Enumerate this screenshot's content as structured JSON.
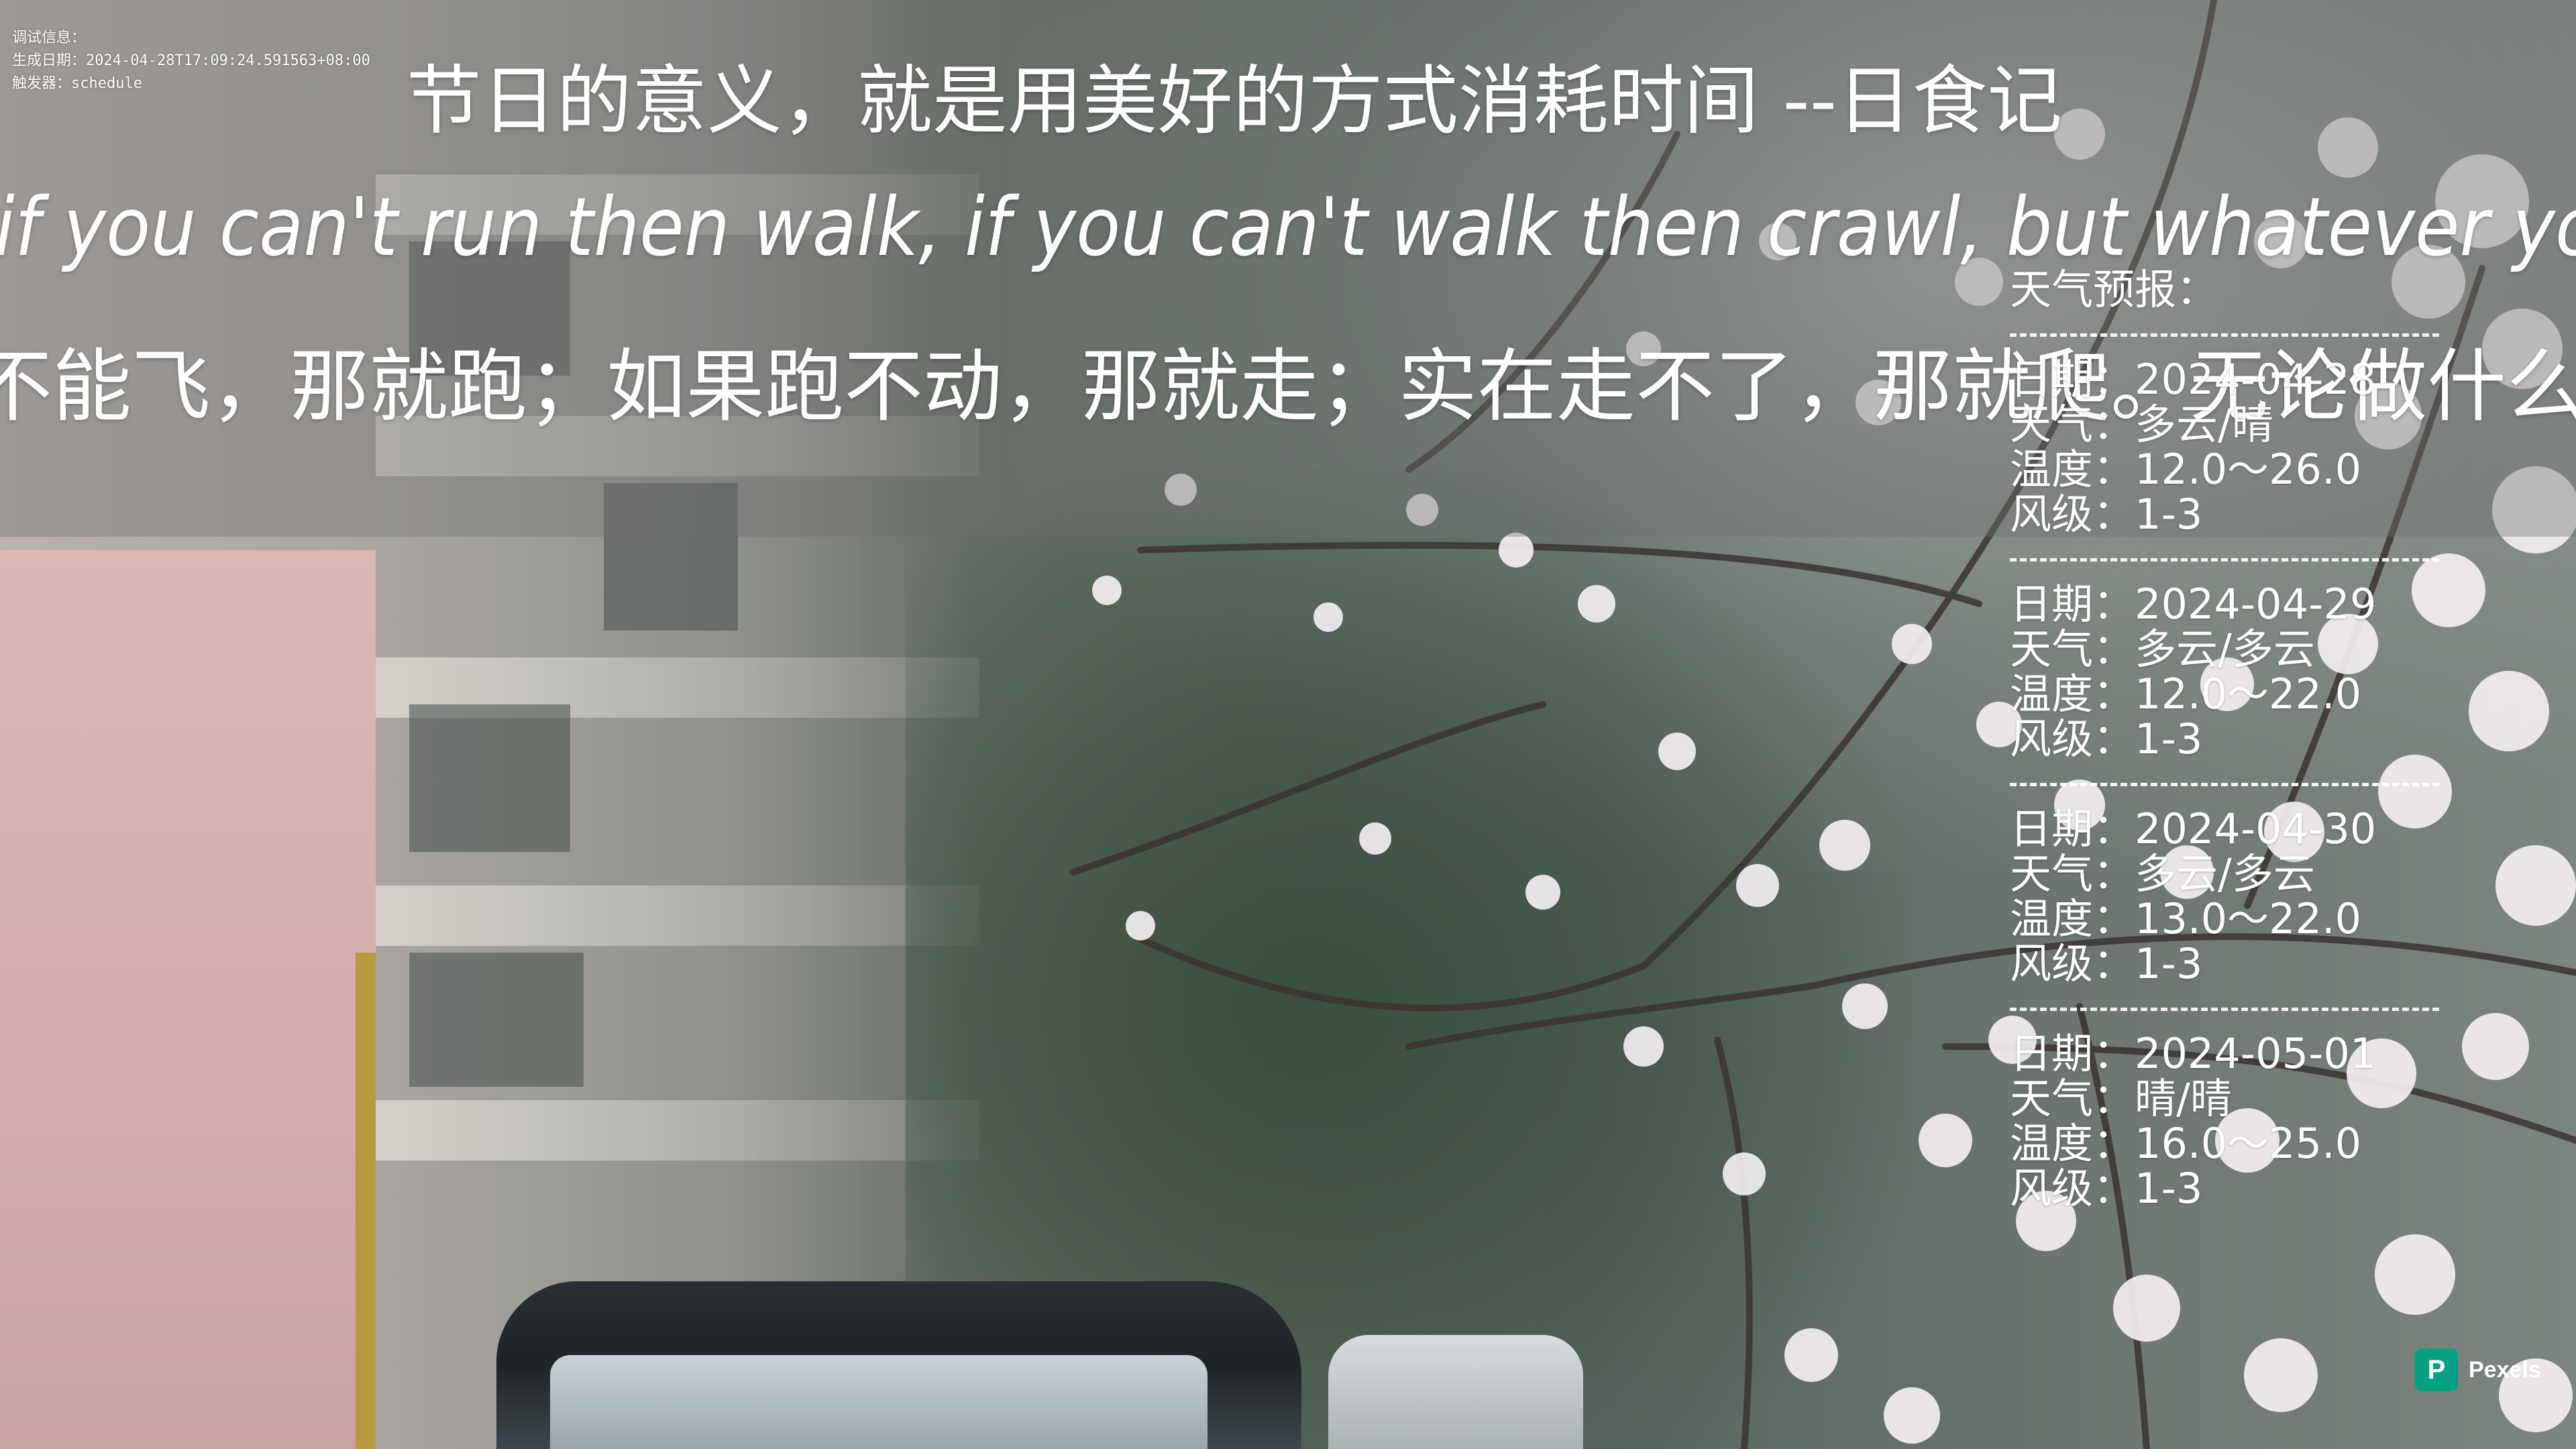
{
  "debug": {
    "label": "调试信息：",
    "generated": "生成日期：2024-04-28T17:09:24.591563+08:00",
    "trigger": "触发器：schedule"
  },
  "quotes": {
    "top": "节日的意义，就是用美好的方式消耗时间 --日食记",
    "english": "if you can't run then walk, if you can't walk then crawl, but whatever you do you have t",
    "chinese": "不能飞，那就跑；如果跑不动，那就走；实在走不了，那就爬。无论做什么，你都要勇往直"
  },
  "weather": {
    "title": "天气预报：",
    "divider": "----------------------------",
    "days": [
      {
        "date": "日期：2024-04-28",
        "weather": "天气：多云/晴",
        "temp": "温度：12.0～26.0",
        "wind": "风级：1-3"
      },
      {
        "date": "日期：2024-04-29",
        "weather": "天气：多云/多云",
        "temp": "温度：12.0～22.0",
        "wind": "风级：1-3"
      },
      {
        "date": "日期：2024-04-30",
        "weather": "天气：多云/多云",
        "temp": "温度：13.0～22.0",
        "wind": "风级：1-3"
      },
      {
        "date": "日期：2024-05-01",
        "weather": "天气：晴/晴",
        "temp": "温度：16.0～25.0",
        "wind": "风级：1-3"
      }
    ]
  },
  "watermark": {
    "brand": "Pexels",
    "icon": "pexels-logo-icon",
    "icon_color": "#05a081"
  }
}
